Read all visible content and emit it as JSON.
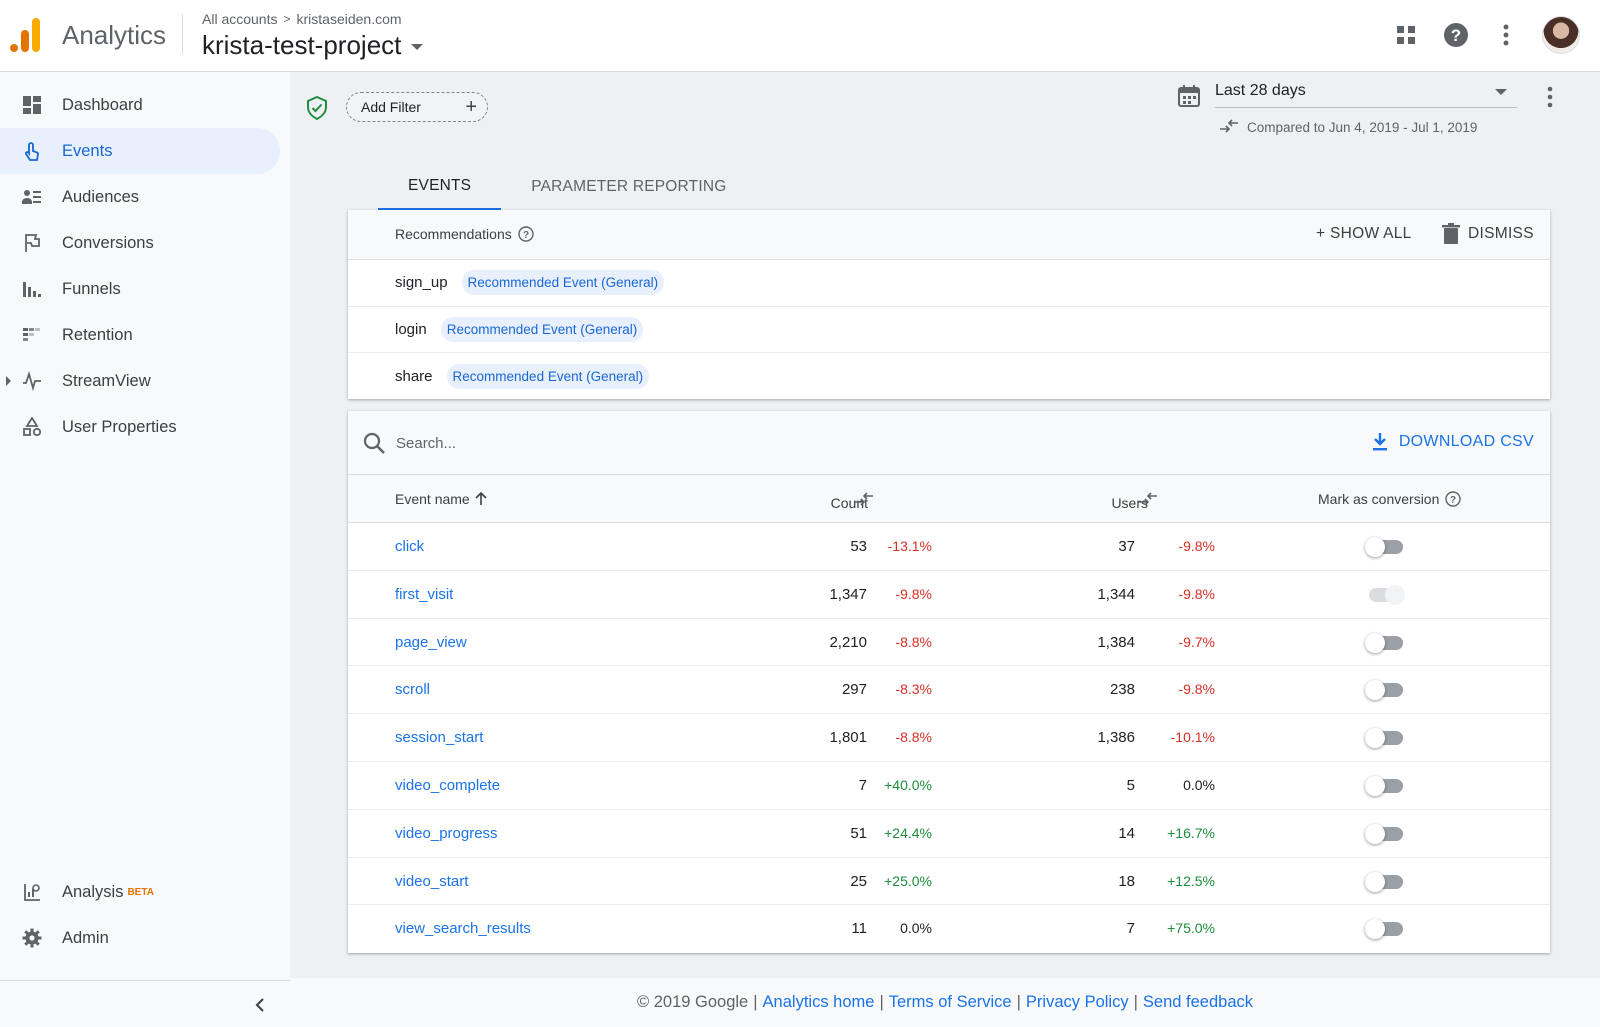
{
  "header": {
    "app_title": "Analytics",
    "breadcrumb": [
      "All accounts",
      "kristaseiden.com"
    ],
    "breadcrumb_sep": ">",
    "project": "krista-test-project",
    "icons": [
      "apps-grid-icon",
      "help-icon",
      "more-vert-icon",
      "avatar"
    ]
  },
  "sidebar": {
    "items": [
      {
        "label": "Dashboard",
        "icon": "dashboard-icon"
      },
      {
        "label": "Events",
        "icon": "touch-icon",
        "active": true
      },
      {
        "label": "Audiences",
        "icon": "audiences-icon"
      },
      {
        "label": "Conversions",
        "icon": "flag-icon"
      },
      {
        "label": "Funnels",
        "icon": "funnel-chart-icon"
      },
      {
        "label": "Retention",
        "icon": "retention-icon"
      },
      {
        "label": "StreamView",
        "icon": "streamview-icon"
      },
      {
        "label": "User Properties",
        "icon": "shapes-icon"
      }
    ],
    "bottom_items": [
      {
        "label": "Analysis",
        "badge": "BETA",
        "icon": "analysis-icon"
      },
      {
        "label": "Admin",
        "icon": "gear-icon"
      }
    ]
  },
  "toolbar": {
    "add_filter": "Add Filter",
    "date_range": "Last 28 days",
    "compare_text": "Compared to Jun 4, 2019 - Jul 1, 2019"
  },
  "tabs": [
    {
      "label": "EVENTS",
      "active": true
    },
    {
      "label": "PARAMETER REPORTING"
    }
  ],
  "recommendations": {
    "title": "Recommendations",
    "show_all": "+ SHOW ALL",
    "dismiss": "DISMISS",
    "rows": [
      {
        "event": "sign_up",
        "chip": "Recommended Event (General)"
      },
      {
        "event": "login",
        "chip": "Recommended Event (General)"
      },
      {
        "event": "share",
        "chip": "Recommended Event (General)"
      }
    ]
  },
  "table": {
    "search_placeholder": "Search...",
    "download": "DOWNLOAD CSV",
    "columns": {
      "event_name": "Event name",
      "count": "Count",
      "users": "Users",
      "mark": "Mark as conversion"
    },
    "rows": [
      {
        "name": "click",
        "count": "53",
        "count_change": "-13.1%",
        "users": "37",
        "users_change": "-9.8%",
        "conversion": false
      },
      {
        "name": "first_visit",
        "count": "1,347",
        "count_change": "-9.8%",
        "users": "1,344",
        "users_change": "-9.8%",
        "conversion": true,
        "disabled": true
      },
      {
        "name": "page_view",
        "count": "2,210",
        "count_change": "-8.8%",
        "users": "1,384",
        "users_change": "-9.7%",
        "conversion": false
      },
      {
        "name": "scroll",
        "count": "297",
        "count_change": "-8.3%",
        "users": "238",
        "users_change": "-9.8%",
        "conversion": false
      },
      {
        "name": "session_start",
        "count": "1,801",
        "count_change": "-8.8%",
        "users": "1,386",
        "users_change": "-10.1%",
        "conversion": false
      },
      {
        "name": "video_complete",
        "count": "7",
        "count_change": "+40.0%",
        "users": "5",
        "users_change": "0.0%",
        "conversion": false
      },
      {
        "name": "video_progress",
        "count": "51",
        "count_change": "+24.4%",
        "users": "14",
        "users_change": "+16.7%",
        "conversion": false
      },
      {
        "name": "video_start",
        "count": "25",
        "count_change": "+25.0%",
        "users": "18",
        "users_change": "+12.5%",
        "conversion": false
      },
      {
        "name": "view_search_results",
        "count": "11",
        "count_change": "0.0%",
        "users": "7",
        "users_change": "+75.0%",
        "conversion": false
      }
    ]
  },
  "footer": {
    "copyright": "© 2019 Google",
    "links": [
      "Analytics home",
      "Terms of Service",
      "Privacy Policy",
      "Send feedback"
    ],
    "separator": "|"
  },
  "colors": {
    "accent": "#1a73e8",
    "negative": "#d93025",
    "positive": "#1e8e3e",
    "logo_orange": "#e37400",
    "logo_yellow": "#f9ab00"
  }
}
